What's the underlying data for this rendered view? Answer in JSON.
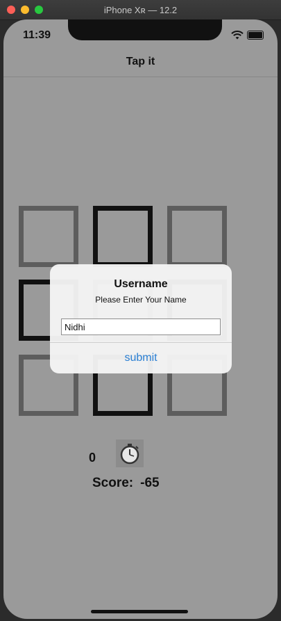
{
  "window": {
    "title": "iPhone Xʀ — 12.2"
  },
  "status_bar": {
    "time": "11:39",
    "icons": [
      "wifi-icon",
      "battery-icon"
    ]
  },
  "nav": {
    "title": "Tap it"
  },
  "grid": [
    {
      "style": "gray"
    },
    {
      "style": "dark"
    },
    {
      "style": "gray"
    },
    {
      "style": "dark"
    },
    {
      "style": "gray"
    },
    {
      "style": "dark"
    },
    {
      "style": "gray"
    },
    {
      "style": "dark"
    },
    {
      "style": "gray"
    }
  ],
  "game": {
    "counter": "0",
    "score_label": "Score:",
    "score_value": "-65",
    "timer_icon": "stopwatch-icon"
  },
  "alert": {
    "title": "Username",
    "message": "Please Enter Your Name",
    "input_value": "Nidhi",
    "button_label": "submit"
  },
  "colors": {
    "accent": "#2a7fd3",
    "screen_bg": "#9a9a9a"
  }
}
